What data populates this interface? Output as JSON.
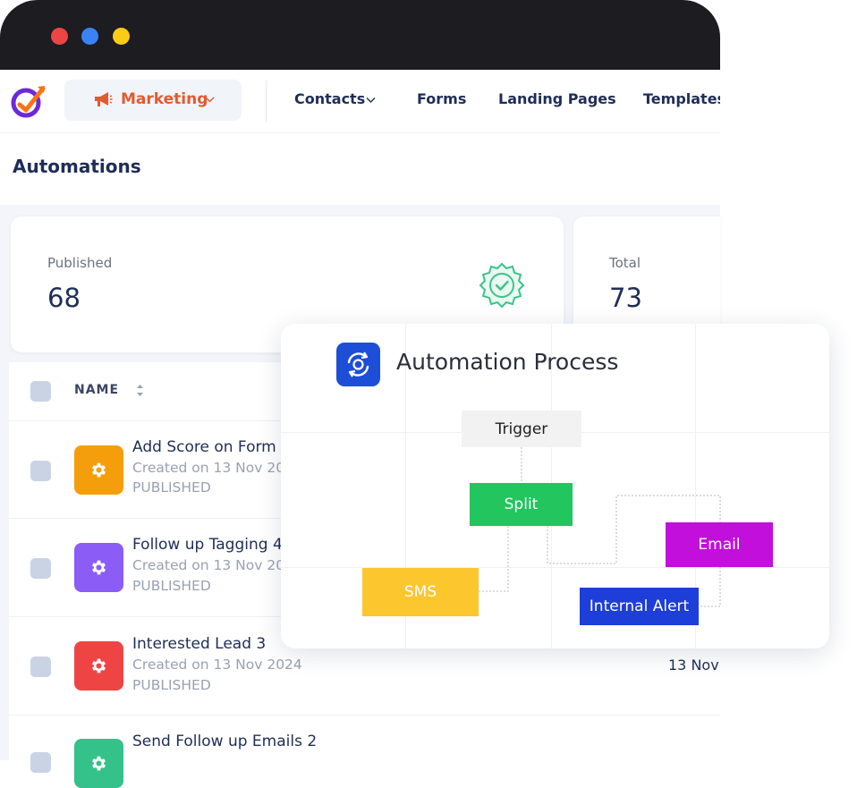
{
  "window": {
    "traffic_lights": [
      "#ef4444",
      "#3b82f6",
      "#facc15"
    ]
  },
  "nav": {
    "logo": "app-logo-icon",
    "marketing_label": "Marketing",
    "items": [
      {
        "label": "Contacts",
        "has_dropdown": true
      },
      {
        "label": "Forms"
      },
      {
        "label": "Landing Pages"
      },
      {
        "label": "Templates"
      }
    ]
  },
  "page": {
    "title": "Automations"
  },
  "stats": [
    {
      "label": "Published",
      "value": "68",
      "icon": "verified-badge-icon"
    },
    {
      "label": "Total",
      "value": "73"
    }
  ],
  "table": {
    "columns": {
      "name": "NAME"
    },
    "rows": [
      {
        "title": "Add Score on Form",
        "created": "Created on 13 Nov 20",
        "status": "PUBLISHED",
        "icon_color": "#f59e0b"
      },
      {
        "title": "Follow up Tagging 4",
        "created": "Created on 13 Nov 20",
        "status": "PUBLISHED",
        "icon_color": "#8b5cf6"
      },
      {
        "title": "Interested Lead 3",
        "created": "Created on 13 Nov 2024",
        "status": "PUBLISHED",
        "date": "13 Nov",
        "icon_color": "#ef4444"
      },
      {
        "title": "Send Follow up Emails 2",
        "icon_color": "#34c18a"
      }
    ]
  },
  "process": {
    "title": "Automation Process",
    "icon": "sync-gear-icon",
    "nodes": {
      "trigger": {
        "label": "Trigger",
        "bg": "#f2f2f3",
        "color": "#1f1f1f"
      },
      "split": {
        "label": "Split",
        "bg": "#22c55e",
        "color": "#ffffff"
      },
      "sms": {
        "label": "SMS",
        "bg": "#fcc62f",
        "color": "#ffffff"
      },
      "email": {
        "label": "Email",
        "bg": "#c20fdb",
        "color": "#ffffff"
      },
      "internal_alert": {
        "label": "Internal Alert",
        "bg": "#1d3ed8",
        "color": "#ffffff"
      }
    }
  }
}
